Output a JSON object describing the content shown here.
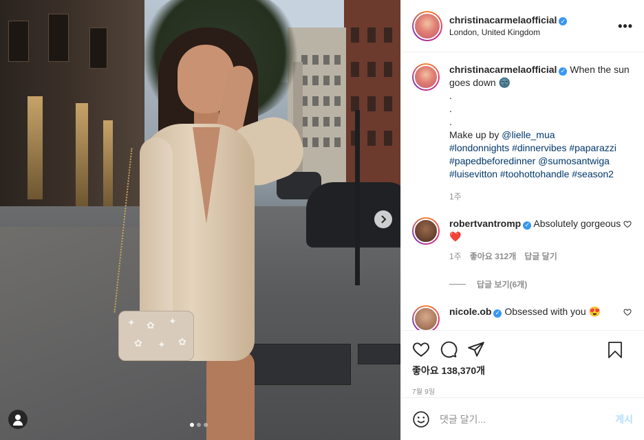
{
  "post": {
    "username": "christinacarmelaofficial",
    "location": "London, United Kingdom",
    "more_icon": "more-options-icon",
    "slide_count": 3,
    "active_slide": 1
  },
  "caption": {
    "username": "christinacarmelaofficial",
    "text_lead": "When the sun goes down 🌚",
    "dots": ".\n.\n.",
    "makeup_prefix": "Make up by ",
    "makeup_tag": "@lielle_mua",
    "hashtags": "#londonnights #dinnervibes #paparazzi #papedbeforedinner @sumosantwiga #luisevitton #toohottohandle #season2",
    "time": "1주"
  },
  "comments": [
    {
      "username": "robertvantromp",
      "text": "Absolutely gorgeous ❤️",
      "time": "1주",
      "likes": "좋아요 312개",
      "reply": "답글 달기",
      "view_replies": "답글 보기(6개)"
    },
    {
      "username": "nicole.ob",
      "text": "Obsessed with you 😍"
    }
  ],
  "actions": {
    "likes": "좋아요 138,370개",
    "date": "7월 9일"
  },
  "composer": {
    "placeholder": "댓글 달기...",
    "post_label": "게시"
  },
  "colors": {
    "verified": "#3897f0",
    "link": "#00376b",
    "post_button_disabled": "#b2dffc",
    "meta_grey": "#8e8e8e"
  }
}
